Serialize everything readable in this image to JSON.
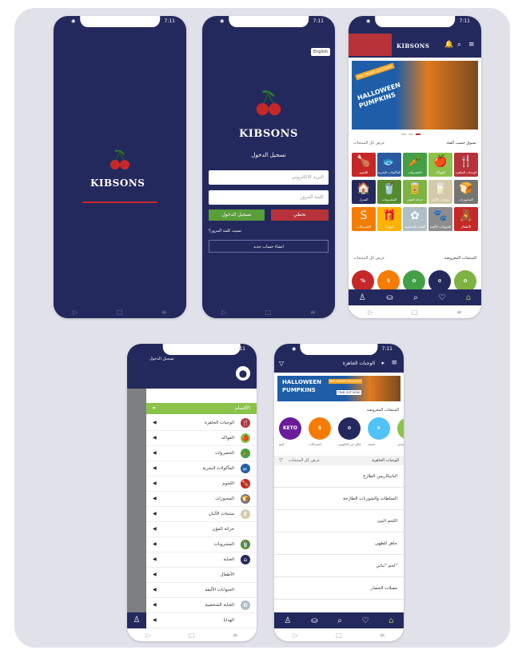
{
  "status": {
    "time": "7:11"
  },
  "splash": {
    "brand": "KIBSONS"
  },
  "login": {
    "lang_button": "English",
    "brand": "KIBSONS",
    "title": "تسجيل الدخول",
    "email_placeholder": "البريد الالكتروني",
    "password_placeholder": "كلمة المرور",
    "login_button": "تسجيل الدخول",
    "skip_button": "تخطي",
    "forgot_link": "نسيت كلمة المرور؟",
    "create_account": "انشاء حساب جديد"
  },
  "home": {
    "brand": "KIBSONS",
    "banner_title_1": "HALLOWEEN",
    "banner_title_2": "PUMPKINS",
    "banner_badge": "PRE-ORDER DISCOUNT",
    "shop_by_category": "تسوق حسب الفئة",
    "view_all_1": "عرض كل المنتجات",
    "featured": "المنتجات المعروضة",
    "view_all_2": "عرض كل المنتجات",
    "categories": [
      {
        "label": "الوجبات الجاهزة",
        "icon": "🍴",
        "color": "#b8323a"
      },
      {
        "label": "الفواكه",
        "icon": "🍎",
        "color": "#8bc34a"
      },
      {
        "label": "الخضروات",
        "icon": "🥕",
        "color": "#43a047"
      },
      {
        "label": "المأكولات البحرية",
        "icon": "🐟",
        "color": "#2c5aa0"
      },
      {
        "label": "اللحوم",
        "icon": "🍗",
        "color": "#c62828"
      },
      {
        "label": "المخبوزات",
        "icon": "🍞",
        "color": "#757575"
      },
      {
        "label": "منتجات الألبان",
        "icon": "🥛",
        "color": "#d4c9a8"
      },
      {
        "label": "خزانة المؤن",
        "icon": "🥫",
        "color": "#7cb342"
      },
      {
        "label": "المشروبات",
        "icon": "🥤",
        "color": "#558b2f"
      },
      {
        "label": "المنزل",
        "icon": "🏠",
        "color": "#24295d"
      },
      {
        "label": "الأطفال",
        "icon": "🧸",
        "color": "#c62828"
      },
      {
        "label": "الحيوانات الأليفة",
        "icon": "🐾",
        "color": "#8d8d8d"
      },
      {
        "label": "العناية الشخصية",
        "icon": "✿",
        "color": "#b0bec5"
      },
      {
        "label": "الهدايا",
        "icon": "🎁",
        "color": "#ffb300"
      },
      {
        "label": "الاشتراكات",
        "icon": "S",
        "color": "#f57c00"
      }
    ],
    "featured_circles": [
      {
        "label": "%",
        "color": "#c62828"
      },
      {
        "label": "S",
        "color": "#f57c00"
      },
      {
        "label": "✿",
        "color": "#43a047"
      },
      {
        "label": "⊘",
        "color": "#24295d"
      },
      {
        "label": "✿",
        "color": "#7cb342"
      }
    ]
  },
  "menu": {
    "login_link": "تسجيل الدخول",
    "section": "الأقسام",
    "items": [
      {
        "label": "الوجبات الجاهزة",
        "icon": "🍴",
        "color": "#b8323a"
      },
      {
        "label": "الفواكه",
        "icon": "🍎",
        "color": "#8bc34a"
      },
      {
        "label": "الخضروات",
        "icon": "🥕",
        "color": "#43a047"
      },
      {
        "label": "المأكولات البحرية",
        "icon": "🐟",
        "color": "#2c5aa0"
      },
      {
        "label": "اللحوم",
        "icon": "🍗",
        "color": "#c62828"
      },
      {
        "label": "المخبوزات",
        "icon": "🍞",
        "color": "#757575"
      },
      {
        "label": "منتجات الألبان",
        "icon": "🥛",
        "color": "#d4c9a8"
      },
      {
        "label": "خزانة المؤن",
        "icon": "",
        "color": ""
      },
      {
        "label": "المشروبات",
        "icon": "🥤",
        "color": "#558b2f"
      },
      {
        "label": "العناية",
        "icon": "⌂",
        "color": "#24295d"
      },
      {
        "label": "الأطفال",
        "icon": "",
        "color": ""
      },
      {
        "label": "الحيوانات الأليفة",
        "icon": "",
        "color": ""
      },
      {
        "label": "العناية الشخصية",
        "icon": "✿",
        "color": "#b0bec5"
      },
      {
        "label": "الهدايا",
        "icon": "",
        "color": ""
      }
    ]
  },
  "list": {
    "title": "الوجبات الجاهزة",
    "banner_title_1": "HALLOWEEN",
    "banner_title_2": "PUMPKINS",
    "banner_badge": "PRE-ORDER DISCOUNT",
    "banner_cta": "FIND OUT NOW",
    "featured": "المنتجات المعروضة",
    "circles": [
      {
        "label": "KETO",
        "caption": "كيتو",
        "color": "#6a1b9a"
      },
      {
        "label": "S",
        "caption": "اشتراكات",
        "color": "#f57c00"
      },
      {
        "label": "⊘",
        "caption": "خالي من الغلوتين",
        "color": "#24295d"
      },
      {
        "label": "❄",
        "caption": "مجمد",
        "color": "#4fc3f7"
      },
      {
        "label": "✿",
        "caption": "نباتي",
        "color": "#8bc34a"
      }
    ],
    "section": "الوجبات الجاهزة",
    "view_all": "عرض كل المنتجات",
    "rows": [
      "الباتيكاريس الطازج",
      "السلطات والشوربات الطازجة",
      "اللحم النيئ",
      "جاهز للطهي",
      "لحم \"نباتي\"",
      "مقبلات الخضار"
    ]
  }
}
